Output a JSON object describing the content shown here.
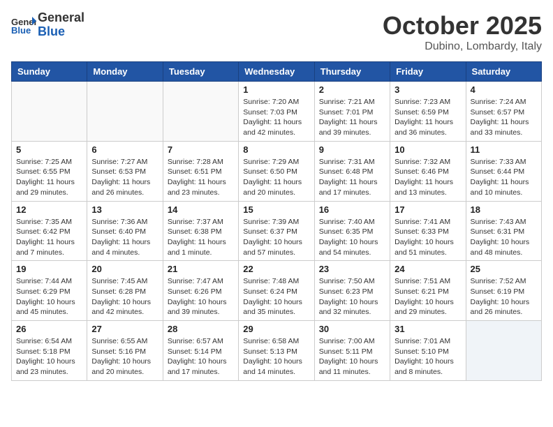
{
  "header": {
    "logo_general": "General",
    "logo_blue": "Blue",
    "month": "October 2025",
    "location": "Dubino, Lombardy, Italy"
  },
  "weekdays": [
    "Sunday",
    "Monday",
    "Tuesday",
    "Wednesday",
    "Thursday",
    "Friday",
    "Saturday"
  ],
  "weeks": [
    [
      {
        "day": "",
        "info": ""
      },
      {
        "day": "",
        "info": ""
      },
      {
        "day": "",
        "info": ""
      },
      {
        "day": "1",
        "info": "Sunrise: 7:20 AM\nSunset: 7:03 PM\nDaylight: 11 hours and 42 minutes."
      },
      {
        "day": "2",
        "info": "Sunrise: 7:21 AM\nSunset: 7:01 PM\nDaylight: 11 hours and 39 minutes."
      },
      {
        "day": "3",
        "info": "Sunrise: 7:23 AM\nSunset: 6:59 PM\nDaylight: 11 hours and 36 minutes."
      },
      {
        "day": "4",
        "info": "Sunrise: 7:24 AM\nSunset: 6:57 PM\nDaylight: 11 hours and 33 minutes."
      }
    ],
    [
      {
        "day": "5",
        "info": "Sunrise: 7:25 AM\nSunset: 6:55 PM\nDaylight: 11 hours and 29 minutes."
      },
      {
        "day": "6",
        "info": "Sunrise: 7:27 AM\nSunset: 6:53 PM\nDaylight: 11 hours and 26 minutes."
      },
      {
        "day": "7",
        "info": "Sunrise: 7:28 AM\nSunset: 6:51 PM\nDaylight: 11 hours and 23 minutes."
      },
      {
        "day": "8",
        "info": "Sunrise: 7:29 AM\nSunset: 6:50 PM\nDaylight: 11 hours and 20 minutes."
      },
      {
        "day": "9",
        "info": "Sunrise: 7:31 AM\nSunset: 6:48 PM\nDaylight: 11 hours and 17 minutes."
      },
      {
        "day": "10",
        "info": "Sunrise: 7:32 AM\nSunset: 6:46 PM\nDaylight: 11 hours and 13 minutes."
      },
      {
        "day": "11",
        "info": "Sunrise: 7:33 AM\nSunset: 6:44 PM\nDaylight: 11 hours and 10 minutes."
      }
    ],
    [
      {
        "day": "12",
        "info": "Sunrise: 7:35 AM\nSunset: 6:42 PM\nDaylight: 11 hours and 7 minutes."
      },
      {
        "day": "13",
        "info": "Sunrise: 7:36 AM\nSunset: 6:40 PM\nDaylight: 11 hours and 4 minutes."
      },
      {
        "day": "14",
        "info": "Sunrise: 7:37 AM\nSunset: 6:38 PM\nDaylight: 11 hours and 1 minute."
      },
      {
        "day": "15",
        "info": "Sunrise: 7:39 AM\nSunset: 6:37 PM\nDaylight: 10 hours and 57 minutes."
      },
      {
        "day": "16",
        "info": "Sunrise: 7:40 AM\nSunset: 6:35 PM\nDaylight: 10 hours and 54 minutes."
      },
      {
        "day": "17",
        "info": "Sunrise: 7:41 AM\nSunset: 6:33 PM\nDaylight: 10 hours and 51 minutes."
      },
      {
        "day": "18",
        "info": "Sunrise: 7:43 AM\nSunset: 6:31 PM\nDaylight: 10 hours and 48 minutes."
      }
    ],
    [
      {
        "day": "19",
        "info": "Sunrise: 7:44 AM\nSunset: 6:29 PM\nDaylight: 10 hours and 45 minutes."
      },
      {
        "day": "20",
        "info": "Sunrise: 7:45 AM\nSunset: 6:28 PM\nDaylight: 10 hours and 42 minutes."
      },
      {
        "day": "21",
        "info": "Sunrise: 7:47 AM\nSunset: 6:26 PM\nDaylight: 10 hours and 39 minutes."
      },
      {
        "day": "22",
        "info": "Sunrise: 7:48 AM\nSunset: 6:24 PM\nDaylight: 10 hours and 35 minutes."
      },
      {
        "day": "23",
        "info": "Sunrise: 7:50 AM\nSunset: 6:23 PM\nDaylight: 10 hours and 32 minutes."
      },
      {
        "day": "24",
        "info": "Sunrise: 7:51 AM\nSunset: 6:21 PM\nDaylight: 10 hours and 29 minutes."
      },
      {
        "day": "25",
        "info": "Sunrise: 7:52 AM\nSunset: 6:19 PM\nDaylight: 10 hours and 26 minutes."
      }
    ],
    [
      {
        "day": "26",
        "info": "Sunrise: 6:54 AM\nSunset: 5:18 PM\nDaylight: 10 hours and 23 minutes."
      },
      {
        "day": "27",
        "info": "Sunrise: 6:55 AM\nSunset: 5:16 PM\nDaylight: 10 hours and 20 minutes."
      },
      {
        "day": "28",
        "info": "Sunrise: 6:57 AM\nSunset: 5:14 PM\nDaylight: 10 hours and 17 minutes."
      },
      {
        "day": "29",
        "info": "Sunrise: 6:58 AM\nSunset: 5:13 PM\nDaylight: 10 hours and 14 minutes."
      },
      {
        "day": "30",
        "info": "Sunrise: 7:00 AM\nSunset: 5:11 PM\nDaylight: 10 hours and 11 minutes."
      },
      {
        "day": "31",
        "info": "Sunrise: 7:01 AM\nSunset: 5:10 PM\nDaylight: 10 hours and 8 minutes."
      },
      {
        "day": "",
        "info": ""
      }
    ]
  ]
}
